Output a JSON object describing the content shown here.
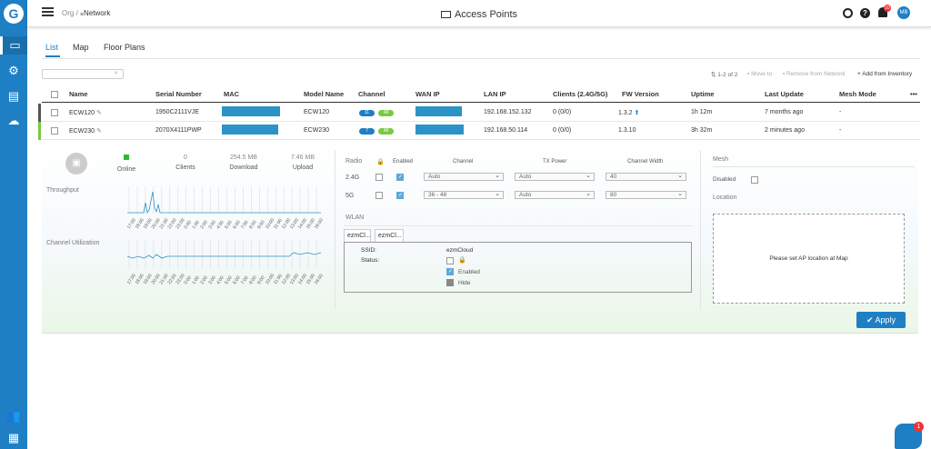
{
  "header": {
    "org": "Org",
    "sep": "/",
    "network": "Network",
    "title": "Access Points",
    "avatar_initials": "MB",
    "notif_count": "10"
  },
  "tabs": [
    "List",
    "Map",
    "Floor Plans"
  ],
  "search": {
    "placeholder": ""
  },
  "toolbar": {
    "pager": "1-2 of 2",
    "move": "Move to",
    "remove": "Remove from Network",
    "add": "Add from Inventory"
  },
  "columns": [
    "Name",
    "Serial Number",
    "MAC",
    "Model Name",
    "Channel",
    "WAN IP",
    "LAN IP",
    "Clients (2.4G/5G)",
    "FW Version",
    "Uptime",
    "Last Update",
    "Mesh Mode"
  ],
  "rows": [
    {
      "name": "ECW120",
      "serial": "1950C2111VJE",
      "model": "ECW120",
      "ch24": "11",
      "ch5": "48",
      "lan": "192.168.152.132",
      "clients": "0 (0/0)",
      "fw": "1.3.2",
      "uptime": "1h 12m",
      "last_update": "7 months ago",
      "mesh": "-",
      "status_color": "#555555"
    },
    {
      "name": "ECW230",
      "serial": "2070X4111PWP",
      "model": "ECW230",
      "ch24": "7",
      "ch5": "48",
      "lan": "192.168.50.114",
      "clients": "0 (0/0)",
      "fw": "1.3.10",
      "uptime": "3h 32m",
      "last_update": "2 minutes ago",
      "mesh": "-",
      "status_color": "#7ac943"
    }
  ],
  "detail": {
    "online": "Online",
    "clients_v": "0",
    "clients_l": "Clients",
    "download_v": "254.5 MB",
    "download_l": "Download",
    "upload_v": "7.46 MB",
    "upload_l": "Upload",
    "throughput": "Throughput",
    "channel_util": "Channel Utilization",
    "time_ticks": [
      "17:00",
      "18:00",
      "19:00",
      "20:00",
      "21:00",
      "22:00",
      "23:00",
      "0:00",
      "1:00",
      "2:00",
      "3:00",
      "4:00",
      "5:00",
      "6:00",
      "7:00",
      "8:00",
      "9:00",
      "10:00",
      "11:00",
      "12:00",
      "13:00",
      "14:00",
      "15:00",
      "16:00"
    ],
    "radio": {
      "radio_h": "Radio",
      "enabled_h": "Enabled",
      "channel_h": "Channel",
      "txpower_h": "TX Power",
      "width_h": "Channel Width",
      "r24": {
        "label": "2.4G",
        "channel": "Auto",
        "tx": "Auto",
        "width": "40"
      },
      "r5": {
        "label": "5G",
        "channel": "36 - 48",
        "tx": "Auto",
        "width": "80"
      }
    },
    "wlan": {
      "title": "WLAN",
      "tab1": "ezmCl...",
      "tab2": "ezmCl...",
      "ssid_l": "SSID:",
      "ssid_v": "ezmCloud",
      "status_l": "Status:",
      "enabled": "Enabled",
      "hide": "Hide"
    },
    "mesh": {
      "title": "Mesh",
      "disabled": "Disabled",
      "location": "Location",
      "placeholder": "Please set AP location at Map"
    },
    "apply": "Apply"
  },
  "colors": {
    "accent": "#1f7fc4",
    "online": "#2eb82e",
    "ch24": "#1f7fc4",
    "ch5": "#7ac943"
  }
}
